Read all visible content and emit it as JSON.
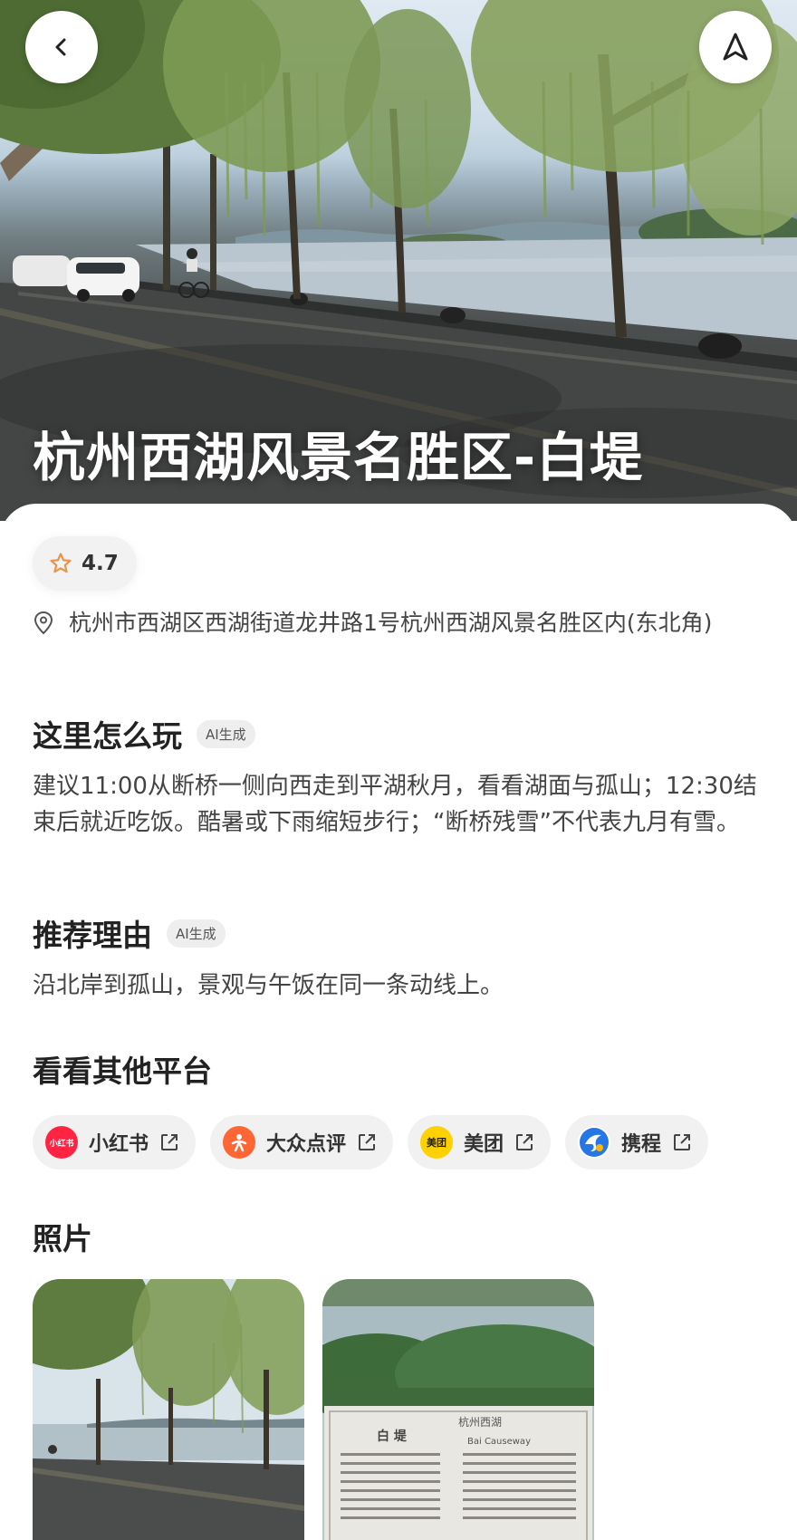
{
  "hero": {
    "title": "杭州西湖风景名胜区-白堤"
  },
  "rating": {
    "value": "4.7",
    "icon": "star-outline-icon",
    "color": "#e8954a"
  },
  "address": {
    "icon": "location-pin-icon",
    "text": "杭州市西湖区西湖街道龙井路1号杭州西湖风景名胜区内(东北角)"
  },
  "how_to_play": {
    "title": "这里怎么玩",
    "badge": "AI生成",
    "text": "建议11:00从断桥一侧向西走到平湖秋月，看看湖面与孤山；12:30结束后就近吃饭。酷暑或下雨缩短步行；“断桥残雪”不代表九月有雪。"
  },
  "reason": {
    "title": "推荐理由",
    "badge": "AI生成",
    "text": "沿北岸到孤山，景观与午饭在同一条动线上。"
  },
  "platforms": {
    "title": "看看其他平台",
    "items": [
      {
        "label": "小红书",
        "logo_text": "小红书",
        "color": "#ff2442",
        "icon": "external-link-icon"
      },
      {
        "label": "大众点评",
        "logo_text": "",
        "color": "#ff6633",
        "icon": "external-link-icon"
      },
      {
        "label": "美团",
        "logo_text": "美团",
        "color": "#ffd100",
        "icon": "external-link-icon"
      },
      {
        "label": "携程",
        "logo_text": "",
        "color": "#2577e3",
        "icon": "external-link-icon"
      }
    ]
  },
  "photos": {
    "title": "照片",
    "sign_title": "杭州西湖",
    "sign_heading": "白 堤",
    "sign_en": "Bai Causeway"
  },
  "toolbar": {
    "back_icon": "back-arrow-icon",
    "navigate_icon": "navigate-arrow-icon"
  }
}
